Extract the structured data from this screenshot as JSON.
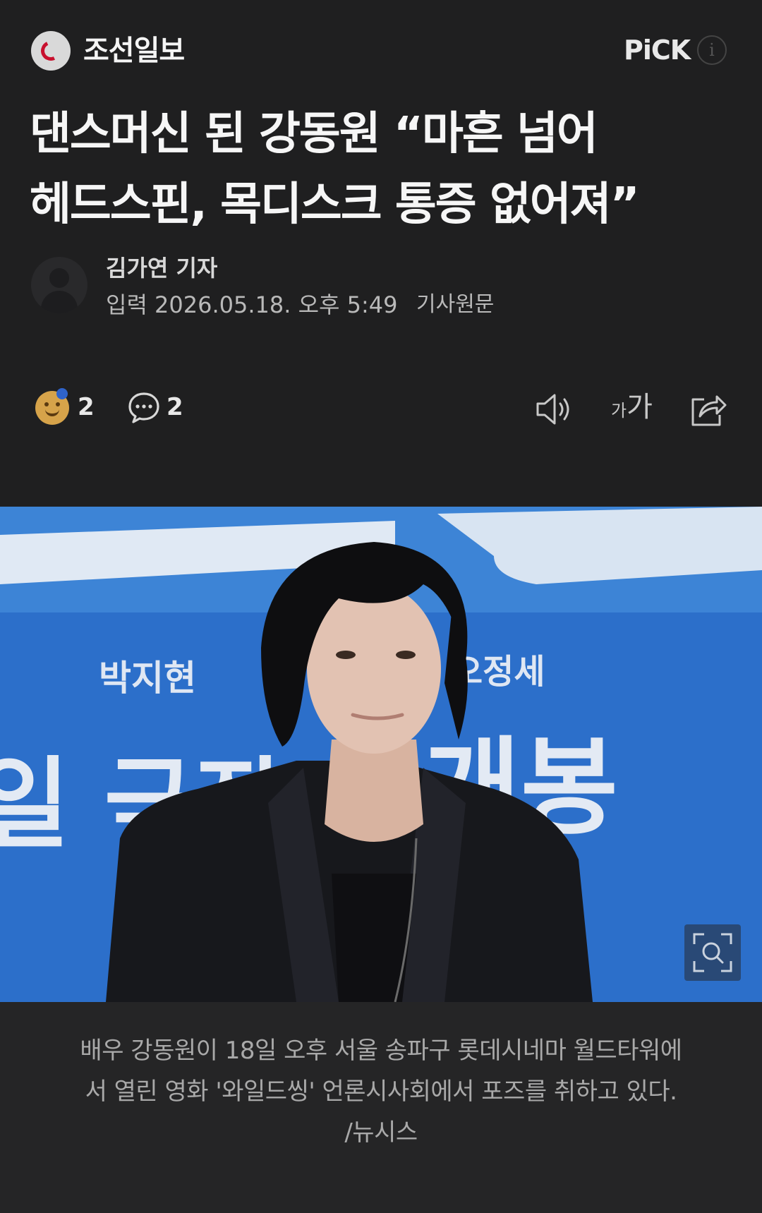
{
  "press": {
    "name": "조선일보",
    "pick_label": "PiCK",
    "info_icon": "i"
  },
  "article": {
    "headline_line1": "댄스머신 된 강동원 “마흔 넘어",
    "headline_line2": "헤드스핀, 목디스크 통증 없어져”",
    "reporter": "김가연 기자",
    "published": "입력 2026.05.18. 오후 5:49",
    "original_link": "기사원문"
  },
  "actions": {
    "reaction_count": "2",
    "comment_count": "2",
    "font_small": "가",
    "font_big": "가"
  },
  "photo": {
    "banner_name_left": "박지현",
    "banner_name_right": "오정세",
    "banner_left_text": "일 극장",
    "banner_right_text": "개봉"
  },
  "caption": {
    "line1": "배우 강동원이 18일 오후 서울 송파구 롯데시네마 월드타워에",
    "line2": "서 열린 영화 '와일드씽' 언론시사회에서 포즈를 취하고 있다.",
    "line3": "/뉴시스"
  },
  "colors": {
    "background": "#1f1f20",
    "logo_red": "#c8102e",
    "banner_blue": "#2a6ec8"
  }
}
